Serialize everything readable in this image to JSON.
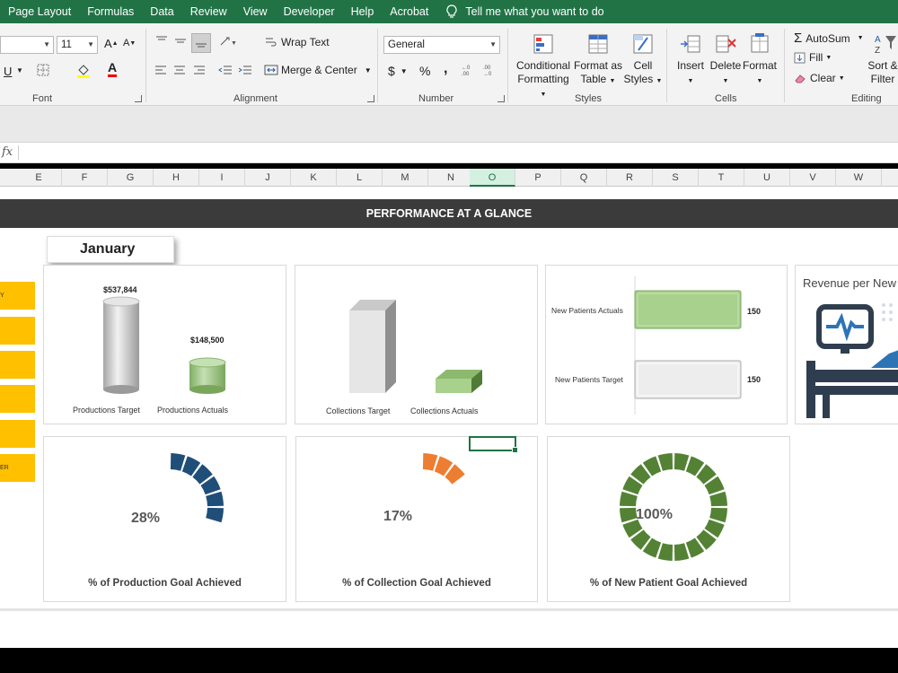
{
  "menu": {
    "tabs": [
      "Page Layout",
      "Formulas",
      "Data",
      "Review",
      "View",
      "Developer",
      "Help",
      "Acrobat"
    ],
    "tell_me": "Tell me what you want to do"
  },
  "ribbon": {
    "font": {
      "size": "11",
      "label": "Font"
    },
    "alignment": {
      "wrap_text": "Wrap Text",
      "merge_center": "Merge & Center",
      "label": "Alignment"
    },
    "number": {
      "format": "General",
      "currency": "$",
      "percent": "%",
      "comma": ",",
      "label": "Number"
    },
    "styles": {
      "conditional": [
        "Conditional",
        "Formatting"
      ],
      "format_table": [
        "Format as",
        "Table"
      ],
      "cell_styles": [
        "Cell",
        "Styles"
      ],
      "label": "Styles"
    },
    "cells": {
      "insert": "Insert",
      "delete": "Delete",
      "format": "Format",
      "label": "Cells"
    },
    "editing": {
      "autosum": "AutoSum",
      "fill": "Fill",
      "clear": "Clear",
      "sort": [
        "Sort &",
        "Filter"
      ],
      "label": "Editing"
    },
    "icons": {
      "increase_font": "A",
      "decrease_font": "A",
      "font_color": "A"
    }
  },
  "formula": {
    "fx": "fx",
    "value": ""
  },
  "columns": [
    "E",
    "F",
    "G",
    "H",
    "I",
    "J",
    "K",
    "L",
    "M",
    "N",
    "O",
    "P",
    "Q",
    "R",
    "S",
    "T",
    "U",
    "V",
    "W"
  ],
  "selected_column": "O",
  "dashboard": {
    "banner": "PERFORMANCE AT A GLANCE",
    "month": "January",
    "side_buttons": [
      "Y",
      "",
      "",
      "",
      "",
      "ER"
    ],
    "production": {
      "target_value": "$537,844",
      "actual_value": "$148,500",
      "target_label": "Productions Target",
      "actual_label": "Productions Actuals"
    },
    "collections": {
      "target_label": "Collections Target",
      "actual_label": "Collections Actuals"
    },
    "patients": {
      "actual_label": "New Patients Actuals",
      "target_label": "New Patients Target",
      "actual_value": "150",
      "target_value": "150"
    },
    "revenue_title": "Revenue per New",
    "gauges": [
      {
        "pct": "28%",
        "fraction": 0.28,
        "color": "#1f4e79",
        "title": "% of Production Goal Achieved"
      },
      {
        "pct": "17%",
        "fraction": 0.17,
        "color": "#ed7d31",
        "title": "% of Collection Goal Achieved"
      },
      {
        "pct": "100%",
        "fraction": 1.0,
        "color": "#548235",
        "title": "% of New Patient Goal Achieved"
      }
    ]
  },
  "colors": {
    "excel_green": "#217346",
    "banner": "#3b3b3b",
    "yellow": "#ffc000",
    "bar_green": "#a9d18e",
    "bar_gray": "#e7e6e6"
  }
}
